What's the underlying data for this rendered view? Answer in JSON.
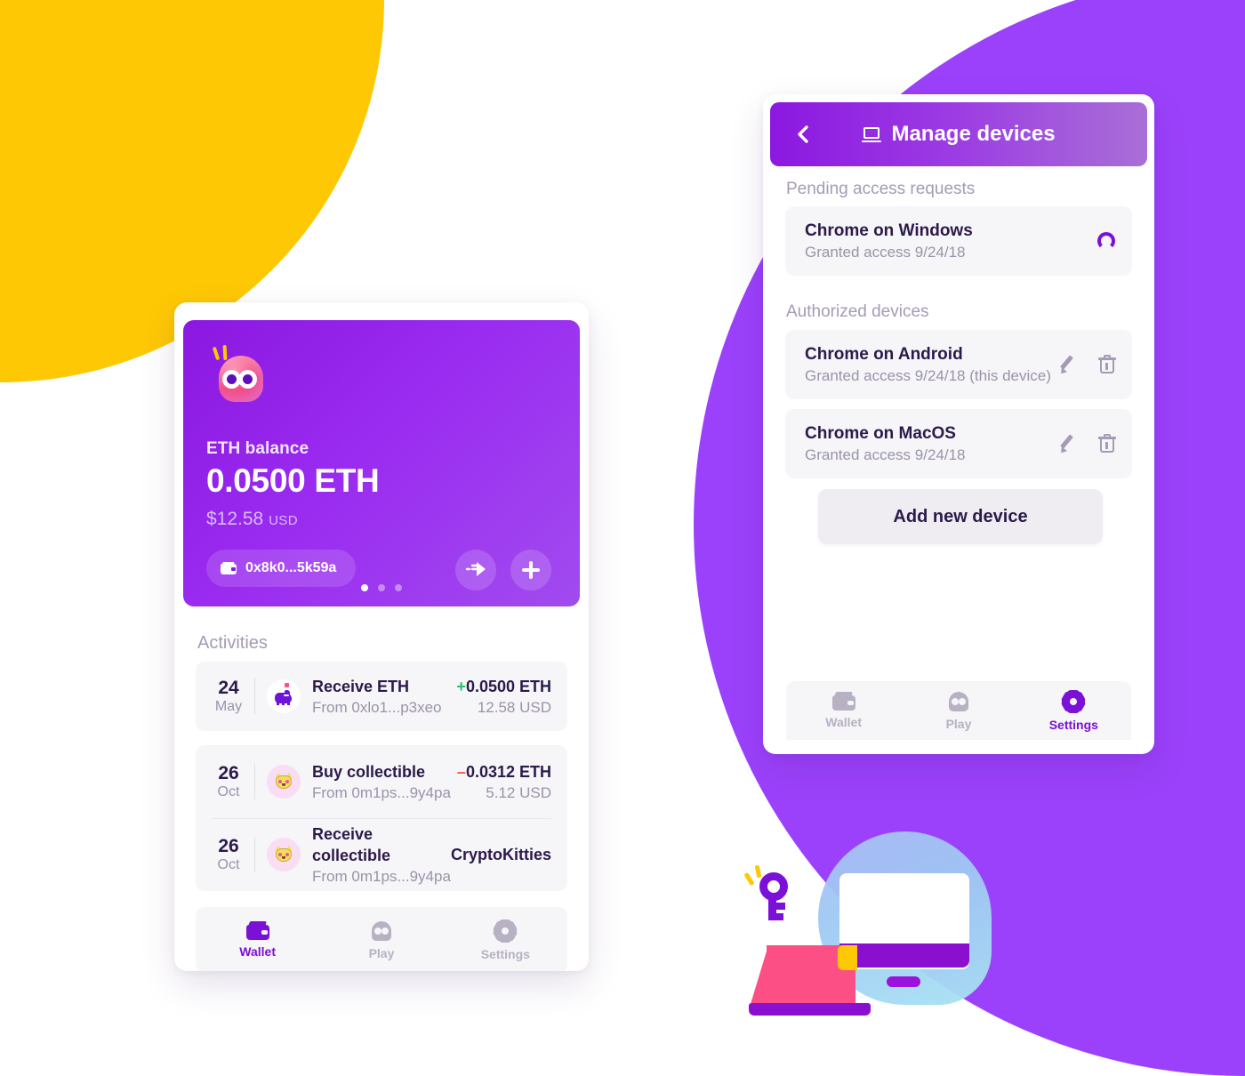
{
  "background": {
    "yellow_circle_color": "#FFC805",
    "purple_blob_color": "#9B41FB"
  },
  "wallet_screen": {
    "balance_card": {
      "mascot_icon": "mascot-blob-icon",
      "label": "ETH balance",
      "amount": "0.0500 ETH",
      "usd_amount": "$12.58",
      "usd_currency": "USD",
      "address": "0x8k0...5k59a",
      "wallet_icon": "wallet-icon",
      "send_button_icon": "send-arrow-icon",
      "add_button_icon": "plus-icon",
      "carousel_dots": 3,
      "active_dot": 0
    },
    "activities": {
      "title": "Activities",
      "items": [
        {
          "day": "24",
          "month": "May",
          "icon": "piggy-bank-icon",
          "title": "Receive ETH",
          "subtitle": "From 0xlo1...p3xeo",
          "amount_sign": "+",
          "amount": "0.0500 ETH",
          "usd": "12.58 USD",
          "direction": "in"
        },
        {
          "day": "26",
          "month": "Oct",
          "icon": "cryptokitty-icon",
          "title": "Buy collectible",
          "subtitle": "From 0m1ps...9y4pa",
          "amount_sign": "–",
          "amount": "0.0312 ETH",
          "usd": "5.12 USD",
          "direction": "out"
        },
        {
          "day": "26",
          "month": "Oct",
          "icon": "cryptokitty-icon",
          "title": "Receive collectible",
          "subtitle": "From 0m1ps...9y4pa",
          "amount_sign": "",
          "amount": "CryptoKitties",
          "usd": "",
          "direction": "none"
        }
      ]
    },
    "tabbar": {
      "tabs": [
        {
          "label": "Wallet",
          "icon": "wallet-icon",
          "active": true
        },
        {
          "label": "Play",
          "icon": "play-blob-icon",
          "active": false
        },
        {
          "label": "Settings",
          "icon": "gear-icon",
          "active": false
        }
      ]
    }
  },
  "devices_screen": {
    "header": {
      "back_icon": "back-chevron-icon",
      "title_icon": "laptop-icon",
      "title": "Manage devices"
    },
    "pending_section": {
      "title": "Pending access requests",
      "items": [
        {
          "name": "Chrome on Windows",
          "meta": "Granted access 9/24/18",
          "status_icon": "pending-spinner-icon"
        }
      ]
    },
    "authorized_section": {
      "title": "Authorized devices",
      "items": [
        {
          "name": "Chrome on Android",
          "meta": "Granted access 9/24/18 (this device)",
          "edit_icon": "pencil-icon",
          "delete_icon": "trash-icon"
        },
        {
          "name": "Chrome on MacOS",
          "meta": "Granted access 9/24/18",
          "edit_icon": "pencil-icon",
          "delete_icon": "trash-icon"
        }
      ]
    },
    "add_device_button": "Add new device",
    "tabbar": {
      "tabs": [
        {
          "label": "Wallet",
          "icon": "wallet-icon",
          "active": false
        },
        {
          "label": "Play",
          "icon": "play-blob-icon",
          "active": false
        },
        {
          "label": "Settings",
          "icon": "gear-icon",
          "active": true
        }
      ]
    }
  },
  "illustration": {
    "name": "laptop-monitor-key-illustration",
    "elements": [
      "key-icon",
      "laptop-icon",
      "monitor-icon"
    ]
  }
}
